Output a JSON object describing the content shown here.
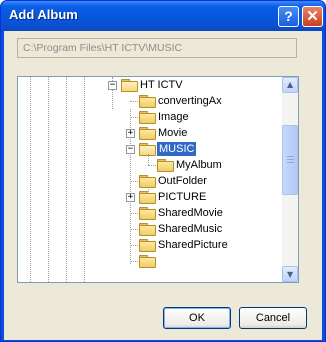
{
  "window": {
    "title": "Add Album"
  },
  "titlebar_buttons": {
    "help": "?",
    "close": "✕"
  },
  "path": {
    "value": "C:\\Program Files\\HT ICTV\\MUSIC"
  },
  "tree": {
    "items": [
      {
        "label": "HT ICTV",
        "expander": "−",
        "icon": "folder-open-icon",
        "selected": false
      },
      {
        "label": "convertingAx",
        "expander": "",
        "icon": "folder-icon",
        "selected": false
      },
      {
        "label": "Image",
        "expander": "",
        "icon": "folder-icon",
        "selected": false
      },
      {
        "label": "Movie",
        "expander": "+",
        "icon": "folder-icon",
        "selected": false
      },
      {
        "label": "MUSIC",
        "expander": "−",
        "icon": "folder-open-icon",
        "selected": true
      },
      {
        "label": "MyAlbum",
        "expander": "",
        "icon": "folder-icon",
        "selected": false
      },
      {
        "label": "OutFolder",
        "expander": "",
        "icon": "folder-icon",
        "selected": false
      },
      {
        "label": "PICTURE",
        "expander": "+",
        "icon": "folder-icon",
        "selected": false
      },
      {
        "label": "SharedMovie",
        "expander": "",
        "icon": "folder-icon",
        "selected": false
      },
      {
        "label": "SharedMusic",
        "expander": "",
        "icon": "folder-icon",
        "selected": false
      },
      {
        "label": "SharedPicture",
        "expander": "",
        "icon": "folder-icon",
        "selected": false
      }
    ]
  },
  "scrollbar": {
    "up_arrow": "▲",
    "down_arrow": "▼"
  },
  "buttons": {
    "ok": "OK",
    "cancel": "Cancel"
  },
  "colors": {
    "titlebar": "#0a5ee6",
    "selection": "#316ac5",
    "dialog_bg": "#ece9d8"
  }
}
